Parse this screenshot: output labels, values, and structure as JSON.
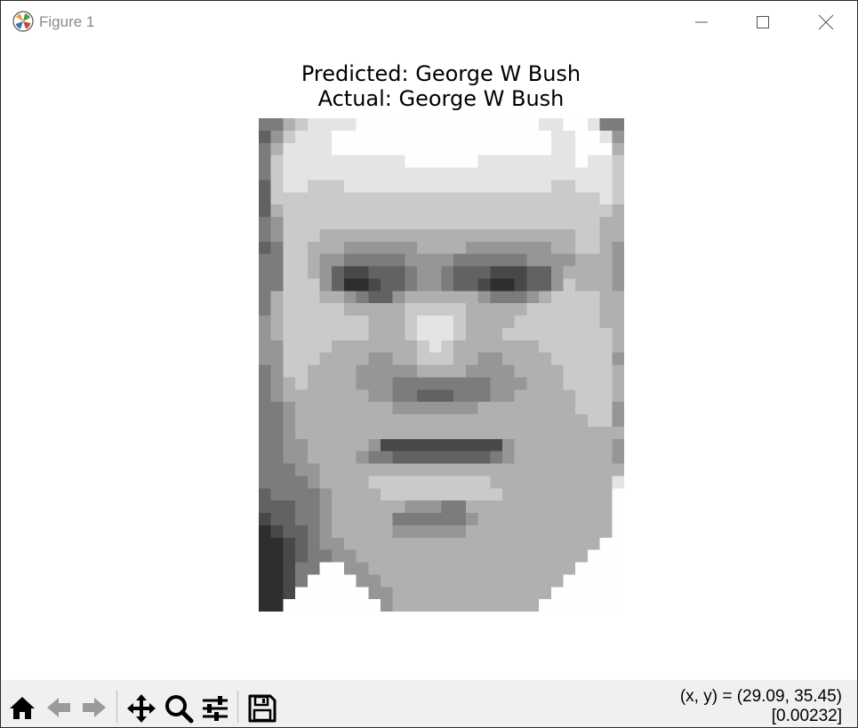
{
  "window": {
    "title": "Figure 1",
    "controls": [
      "minimize",
      "maximize",
      "close"
    ]
  },
  "plot": {
    "title_line1": "Predicted: George W Bush",
    "title_line2": "Actual: George W Bush",
    "image": {
      "colormap": "gray",
      "cols": 30,
      "rows": 40,
      "pixels_pattern": [
        "4467888899999999999999988998442",
        "3578889999999999999999998899852",
        "4688889999999999999999998899963",
        "4788888888889999998888888898873",
        "4788888888888888888888888888873",
        "3788777888888888888888887788874",
        "3777777777777777777777777777873",
        "3677777777777777777777777777763",
        "4577777777777777777777777777664",
        "4577766666666666666666666677665",
        "3477666555555666655555556677654",
        "4477655444445555444444555566654",
        "4477653223334554333222335666654",
        "4477753112334554332112335766654",
        "4677766543356666665444567777664",
        "4677777666667777766666777777664",
        "5677777776667888766667777777665",
        "5677777776667888766677777777765",
        "5577776666666787666666677777765",
        "5577766665566777665566667777755",
        "4577666655555666655556666777765",
        "4567666655544444444555666777765",
        "4566666665544333444556666677764",
        "4456666666655555556666666677755",
        "4456666666666666666666666667754",
        "4456666666666666666666666666662",
        "4455666665222222222256666666651",
        "4455666654433333333456666666652",
        "4445566666666666666666666666662",
        "4444566667777777777666666666683",
        "3444456666777777777766666666699",
        "3334456666665554466666666666699",
        "2334456666644444456666666666699",
        "1233456666655555566666666666699",
        "1123455666666666666666666666999",
        "1123445566666666666666666669999",
        "1124499556666666666666666699999",
        "1124999955666666666666666999999",
        "1129999995566666666666669999999",
        "1199999999566666666666699999999"
      ]
    }
  },
  "toolbar": {
    "tools": [
      "home-icon",
      "back-icon",
      "forward-icon",
      "pan-icon",
      "zoom-icon",
      "configure-subplots-icon",
      "save-icon"
    ],
    "coords_line1": "(x, y) = (29.09, 35.45)",
    "coords_line2": "[0.00232]"
  }
}
